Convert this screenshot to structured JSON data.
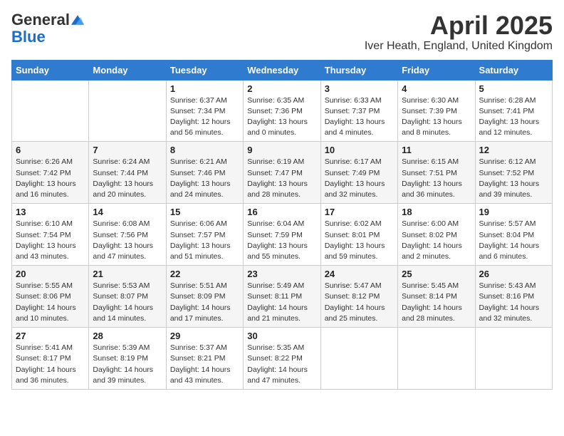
{
  "logo": {
    "general": "General",
    "blue": "Blue"
  },
  "title": "April 2025",
  "subtitle": "Iver Heath, England, United Kingdom",
  "days_of_week": [
    "Sunday",
    "Monday",
    "Tuesday",
    "Wednesday",
    "Thursday",
    "Friday",
    "Saturday"
  ],
  "weeks": [
    [
      {
        "day": null
      },
      {
        "day": null
      },
      {
        "day": "1",
        "sunrise": "Sunrise: 6:37 AM",
        "sunset": "Sunset: 7:34 PM",
        "daylight": "Daylight: 12 hours and 56 minutes."
      },
      {
        "day": "2",
        "sunrise": "Sunrise: 6:35 AM",
        "sunset": "Sunset: 7:36 PM",
        "daylight": "Daylight: 13 hours and 0 minutes."
      },
      {
        "day": "3",
        "sunrise": "Sunrise: 6:33 AM",
        "sunset": "Sunset: 7:37 PM",
        "daylight": "Daylight: 13 hours and 4 minutes."
      },
      {
        "day": "4",
        "sunrise": "Sunrise: 6:30 AM",
        "sunset": "Sunset: 7:39 PM",
        "daylight": "Daylight: 13 hours and 8 minutes."
      },
      {
        "day": "5",
        "sunrise": "Sunrise: 6:28 AM",
        "sunset": "Sunset: 7:41 PM",
        "daylight": "Daylight: 13 hours and 12 minutes."
      }
    ],
    [
      {
        "day": "6",
        "sunrise": "Sunrise: 6:26 AM",
        "sunset": "Sunset: 7:42 PM",
        "daylight": "Daylight: 13 hours and 16 minutes."
      },
      {
        "day": "7",
        "sunrise": "Sunrise: 6:24 AM",
        "sunset": "Sunset: 7:44 PM",
        "daylight": "Daylight: 13 hours and 20 minutes."
      },
      {
        "day": "8",
        "sunrise": "Sunrise: 6:21 AM",
        "sunset": "Sunset: 7:46 PM",
        "daylight": "Daylight: 13 hours and 24 minutes."
      },
      {
        "day": "9",
        "sunrise": "Sunrise: 6:19 AM",
        "sunset": "Sunset: 7:47 PM",
        "daylight": "Daylight: 13 hours and 28 minutes."
      },
      {
        "day": "10",
        "sunrise": "Sunrise: 6:17 AM",
        "sunset": "Sunset: 7:49 PM",
        "daylight": "Daylight: 13 hours and 32 minutes."
      },
      {
        "day": "11",
        "sunrise": "Sunrise: 6:15 AM",
        "sunset": "Sunset: 7:51 PM",
        "daylight": "Daylight: 13 hours and 36 minutes."
      },
      {
        "day": "12",
        "sunrise": "Sunrise: 6:12 AM",
        "sunset": "Sunset: 7:52 PM",
        "daylight": "Daylight: 13 hours and 39 minutes."
      }
    ],
    [
      {
        "day": "13",
        "sunrise": "Sunrise: 6:10 AM",
        "sunset": "Sunset: 7:54 PM",
        "daylight": "Daylight: 13 hours and 43 minutes."
      },
      {
        "day": "14",
        "sunrise": "Sunrise: 6:08 AM",
        "sunset": "Sunset: 7:56 PM",
        "daylight": "Daylight: 13 hours and 47 minutes."
      },
      {
        "day": "15",
        "sunrise": "Sunrise: 6:06 AM",
        "sunset": "Sunset: 7:57 PM",
        "daylight": "Daylight: 13 hours and 51 minutes."
      },
      {
        "day": "16",
        "sunrise": "Sunrise: 6:04 AM",
        "sunset": "Sunset: 7:59 PM",
        "daylight": "Daylight: 13 hours and 55 minutes."
      },
      {
        "day": "17",
        "sunrise": "Sunrise: 6:02 AM",
        "sunset": "Sunset: 8:01 PM",
        "daylight": "Daylight: 13 hours and 59 minutes."
      },
      {
        "day": "18",
        "sunrise": "Sunrise: 6:00 AM",
        "sunset": "Sunset: 8:02 PM",
        "daylight": "Daylight: 14 hours and 2 minutes."
      },
      {
        "day": "19",
        "sunrise": "Sunrise: 5:57 AM",
        "sunset": "Sunset: 8:04 PM",
        "daylight": "Daylight: 14 hours and 6 minutes."
      }
    ],
    [
      {
        "day": "20",
        "sunrise": "Sunrise: 5:55 AM",
        "sunset": "Sunset: 8:06 PM",
        "daylight": "Daylight: 14 hours and 10 minutes."
      },
      {
        "day": "21",
        "sunrise": "Sunrise: 5:53 AM",
        "sunset": "Sunset: 8:07 PM",
        "daylight": "Daylight: 14 hours and 14 minutes."
      },
      {
        "day": "22",
        "sunrise": "Sunrise: 5:51 AM",
        "sunset": "Sunset: 8:09 PM",
        "daylight": "Daylight: 14 hours and 17 minutes."
      },
      {
        "day": "23",
        "sunrise": "Sunrise: 5:49 AM",
        "sunset": "Sunset: 8:11 PM",
        "daylight": "Daylight: 14 hours and 21 minutes."
      },
      {
        "day": "24",
        "sunrise": "Sunrise: 5:47 AM",
        "sunset": "Sunset: 8:12 PM",
        "daylight": "Daylight: 14 hours and 25 minutes."
      },
      {
        "day": "25",
        "sunrise": "Sunrise: 5:45 AM",
        "sunset": "Sunset: 8:14 PM",
        "daylight": "Daylight: 14 hours and 28 minutes."
      },
      {
        "day": "26",
        "sunrise": "Sunrise: 5:43 AM",
        "sunset": "Sunset: 8:16 PM",
        "daylight": "Daylight: 14 hours and 32 minutes."
      }
    ],
    [
      {
        "day": "27",
        "sunrise": "Sunrise: 5:41 AM",
        "sunset": "Sunset: 8:17 PM",
        "daylight": "Daylight: 14 hours and 36 minutes."
      },
      {
        "day": "28",
        "sunrise": "Sunrise: 5:39 AM",
        "sunset": "Sunset: 8:19 PM",
        "daylight": "Daylight: 14 hours and 39 minutes."
      },
      {
        "day": "29",
        "sunrise": "Sunrise: 5:37 AM",
        "sunset": "Sunset: 8:21 PM",
        "daylight": "Daylight: 14 hours and 43 minutes."
      },
      {
        "day": "30",
        "sunrise": "Sunrise: 5:35 AM",
        "sunset": "Sunset: 8:22 PM",
        "daylight": "Daylight: 14 hours and 47 minutes."
      },
      {
        "day": null
      },
      {
        "day": null
      },
      {
        "day": null
      }
    ]
  ]
}
